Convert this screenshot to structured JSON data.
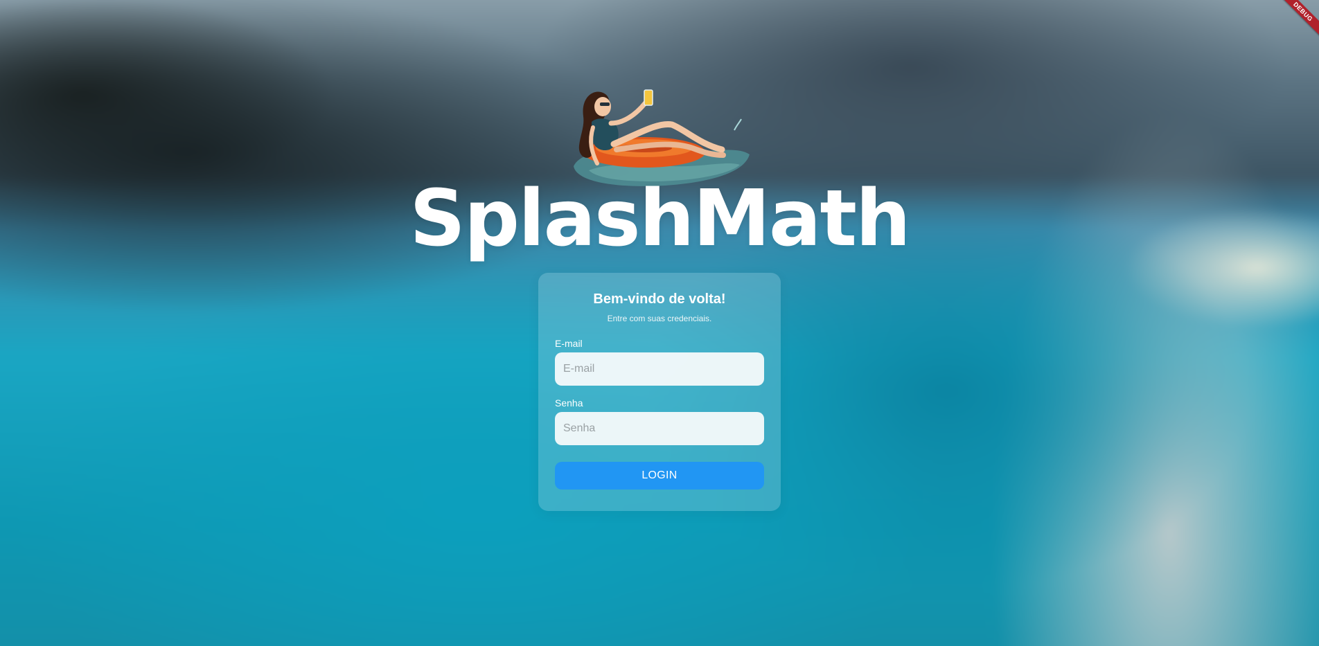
{
  "app": {
    "title": "SplashMath",
    "debug_banner": "DEBUG"
  },
  "illustration": {
    "icon": "woman-on-pool-float-illustration"
  },
  "login_card": {
    "title": "Bem-vindo de volta!",
    "subtitle": "Entre com suas credenciais.",
    "email": {
      "label": "E-mail",
      "placeholder": "E-mail",
      "value": ""
    },
    "password": {
      "label": "Senha",
      "placeholder": "Senha",
      "value": ""
    },
    "submit_label": "LOGIN"
  },
  "colors": {
    "primary_button": "#2196f3",
    "debug_banner": "#b0212b",
    "title_text": "#ffffff"
  }
}
